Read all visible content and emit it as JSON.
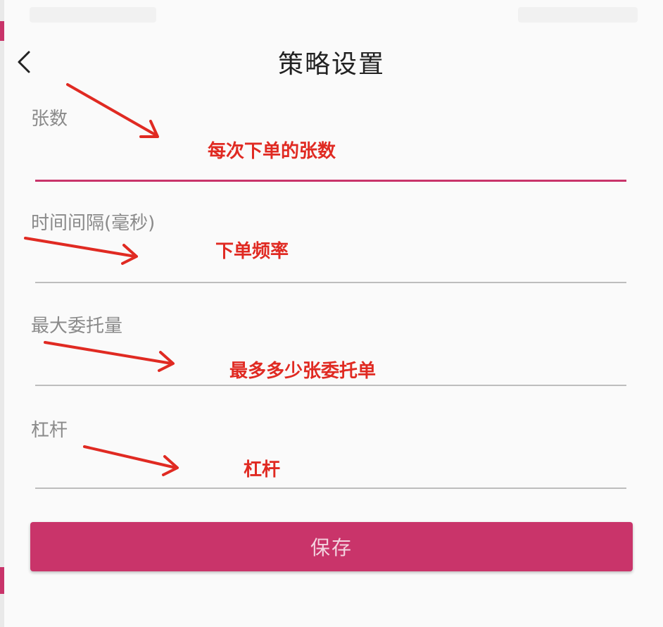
{
  "header": {
    "title": "策略设置",
    "back_icon": "chevron-left-icon"
  },
  "form": {
    "fields": [
      {
        "label": "张数",
        "value": "",
        "annotation": "每次下单的张数",
        "focused": true
      },
      {
        "label": "时间间隔(毫秒)",
        "value": "",
        "annotation": "下单频率",
        "focused": false
      },
      {
        "label": "最大委托量",
        "value": "",
        "annotation": "最多多少张委托单",
        "focused": false
      },
      {
        "label": "杠杆",
        "value": "",
        "annotation": "杠杆",
        "focused": false
      }
    ],
    "save_label": "保存"
  },
  "colors": {
    "accent": "#c9346a",
    "annotation": "#e02a22",
    "label": "#8a8a8a",
    "background": "#fafafa"
  }
}
